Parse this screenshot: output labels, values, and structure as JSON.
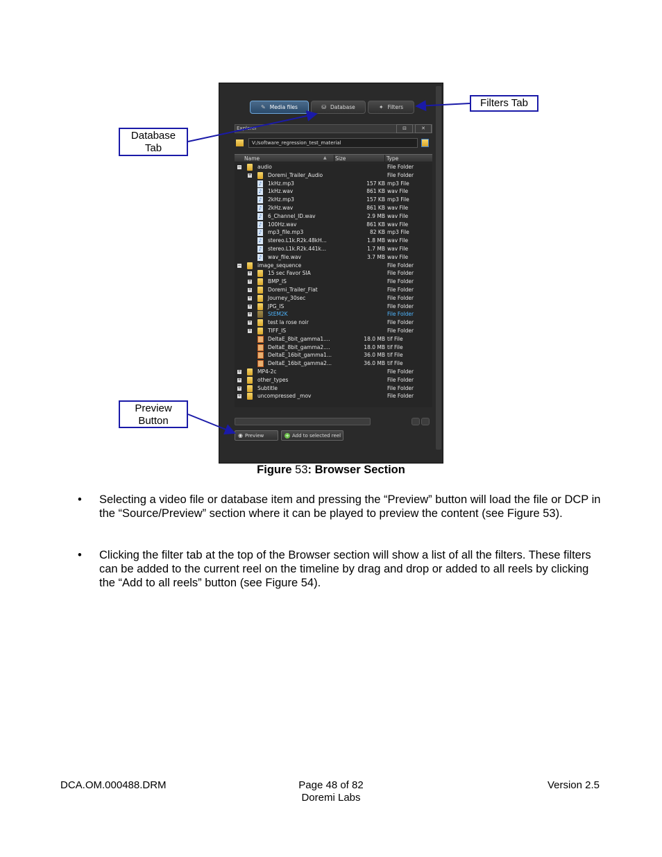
{
  "screenshot": {
    "tabs": [
      {
        "label": "Media files",
        "icon": "film-icon",
        "active": true
      },
      {
        "label": "Database",
        "icon": "database-icon",
        "active": false
      },
      {
        "label": "Filters",
        "icon": "wand-icon",
        "active": false
      }
    ],
    "explorer_label": "Explorer",
    "explorer_btn1": "⊟",
    "explorer_btn2": "✕",
    "path": "V:/software_regression_test_material",
    "columns": {
      "name": "Name",
      "size": "Size",
      "type": "Type"
    },
    "rows": [
      {
        "level": 0,
        "exp": "−",
        "icon": "folder",
        "name": "audio",
        "size": "",
        "type": "File Folder"
      },
      {
        "level": 1,
        "exp": "+",
        "icon": "folder",
        "name": "Doremi_Trailer_Audio",
        "size": "",
        "type": "File Folder"
      },
      {
        "level": 1,
        "exp": "",
        "icon": "audio",
        "name": "1kHz.mp3",
        "size": "157 KB",
        "type": "mp3 File"
      },
      {
        "level": 1,
        "exp": "",
        "icon": "audio",
        "name": "1kHz.wav",
        "size": "861 KB",
        "type": "wav File"
      },
      {
        "level": 1,
        "exp": "",
        "icon": "audio",
        "name": "2kHz.mp3",
        "size": "157 KB",
        "type": "mp3 File"
      },
      {
        "level": 1,
        "exp": "",
        "icon": "audio",
        "name": "2kHz.wav",
        "size": "861 KB",
        "type": "wav File"
      },
      {
        "level": 1,
        "exp": "",
        "icon": "audio",
        "name": "6_Channel_ID.wav",
        "size": "2.9 MB",
        "type": "wav File"
      },
      {
        "level": 1,
        "exp": "",
        "icon": "audio",
        "name": "100Hz.wav",
        "size": "861 KB",
        "type": "wav File"
      },
      {
        "level": 1,
        "exp": "",
        "icon": "audio",
        "name": "mp3_file.mp3",
        "size": "82 KB",
        "type": "mp3 File"
      },
      {
        "level": 1,
        "exp": "",
        "icon": "audio",
        "name": "stereo.L1k.R2k.48kH...",
        "size": "1.8 MB",
        "type": "wav File"
      },
      {
        "level": 1,
        "exp": "",
        "icon": "audio",
        "name": "stereo.L1k.R2k.441k...",
        "size": "1.7 MB",
        "type": "wav File"
      },
      {
        "level": 1,
        "exp": "",
        "icon": "audio",
        "name": "wav_file.wav",
        "size": "3.7 MB",
        "type": "wav File"
      },
      {
        "level": 0,
        "exp": "−",
        "icon": "folder",
        "name": "image_sequence",
        "size": "",
        "type": "File Folder"
      },
      {
        "level": 1,
        "exp": "+",
        "icon": "folder",
        "name": "15 sec Favor SIA",
        "size": "",
        "type": "File Folder"
      },
      {
        "level": 1,
        "exp": "+",
        "icon": "folder",
        "name": "BMP_IS",
        "size": "",
        "type": "File Folder"
      },
      {
        "level": 1,
        "exp": "+",
        "icon": "folder",
        "name": "Doremi_Trailer_Flat",
        "size": "",
        "type": "File Folder"
      },
      {
        "level": 1,
        "exp": "+",
        "icon": "folder",
        "name": "Journey_30sec",
        "size": "",
        "type": "File Folder"
      },
      {
        "level": 1,
        "exp": "+",
        "icon": "folder",
        "name": "JPG_IS",
        "size": "",
        "type": "File Folder"
      },
      {
        "level": 1,
        "exp": "+",
        "icon": "folder-dim",
        "name": "StEM2K",
        "size": "",
        "type": "File Folder",
        "highlight": true
      },
      {
        "level": 1,
        "exp": "+",
        "icon": "folder",
        "name": "test la rose noir",
        "size": "",
        "type": "File Folder"
      },
      {
        "level": 1,
        "exp": "+",
        "icon": "folder",
        "name": "TIFF_IS",
        "size": "",
        "type": "File Folder"
      },
      {
        "level": 1,
        "exp": "",
        "icon": "image",
        "name": "DeltaE_8bit_gamma1....",
        "size": "18.0 MB",
        "type": "tif File"
      },
      {
        "level": 1,
        "exp": "",
        "icon": "image",
        "name": "DeltaE_8bit_gamma2....",
        "size": "18.0 MB",
        "type": "tif File"
      },
      {
        "level": 1,
        "exp": "",
        "icon": "image",
        "name": "DeltaE_16bit_gamma1...",
        "size": "36.0 MB",
        "type": "tif File"
      },
      {
        "level": 1,
        "exp": "",
        "icon": "image",
        "name": "DeltaE_16bit_gamma2...",
        "size": "36.0 MB",
        "type": "tif File"
      },
      {
        "level": 0,
        "exp": "+",
        "icon": "folder",
        "name": "MP4-2c",
        "size": "",
        "type": "File Folder"
      },
      {
        "level": 0,
        "exp": "+",
        "icon": "folder",
        "name": "other_types",
        "size": "",
        "type": "File Folder"
      },
      {
        "level": 0,
        "exp": "+",
        "icon": "folder",
        "name": "Subtitle",
        "size": "",
        "type": "File Folder"
      },
      {
        "level": 0,
        "exp": "+",
        "icon": "folder",
        "name": "uncompressed _mov",
        "size": "",
        "type": "File Folder"
      }
    ],
    "preview_label": "Preview",
    "add_reel_label": "Add to selected reel"
  },
  "callouts": {
    "filters_tab": "Filters Tab",
    "database_tab": "Database Tab",
    "preview_button": "Preview Button"
  },
  "caption": {
    "prefix": "Figure",
    "number": "53",
    "title": ": Browser Section"
  },
  "bullets": [
    "Selecting a video file or database item and pressing the “Preview” button will load the file or DCP in the “Source/Preview” section where it can be played to preview the content (see Figure 53).",
    "Clicking the filter tab at the top of the Browser section will show a list of all the filters. These filters can be added to the current reel on the timeline by drag and drop or added to all reels by clicking the “Add to all reels” button (see Figure 54)."
  ],
  "bullet_char": "•",
  "footer": {
    "doc_id": "DCA.OM.000488.DRM",
    "page": "Page 48 of 82",
    "company": "Doremi Labs",
    "version": "Version 2.5"
  },
  "colors": {
    "callout_border": "#1a1aa8",
    "highlight": "#4fb6ff"
  }
}
